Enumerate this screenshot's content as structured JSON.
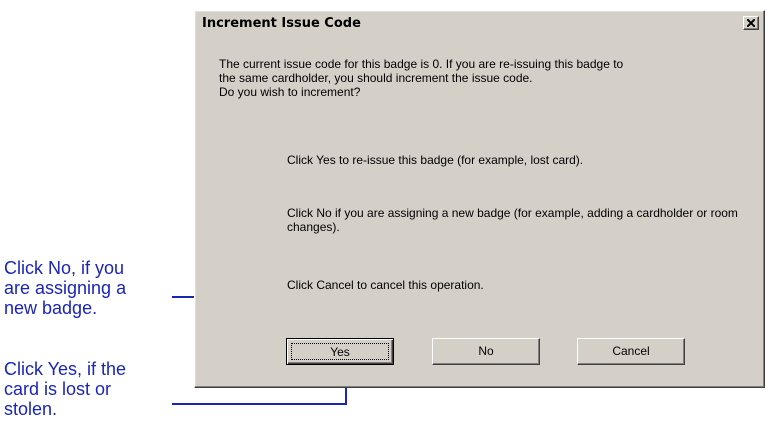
{
  "dialog": {
    "title": "Increment Issue Code",
    "intro_lines": [
      "The current issue code for this badge is 0.  If you are re-issuing this badge to",
      "the same cardholder, you should increment the issue code.",
      "Do you wish to increment?"
    ],
    "yes_hint": "Click Yes to re-issue this badge (for example, lost card).",
    "no_hint": "Click No if you are assigning a new badge (for example, adding a cardholder or room changes).",
    "cancel_hint": "Click Cancel to cancel this operation.",
    "buttons": {
      "yes": "Yes",
      "no": "No",
      "cancel": "Cancel"
    },
    "close_icon": "close-x-icon"
  },
  "callouts": {
    "no": [
      "Click No, if you",
      "are assigning a",
      "new badge."
    ],
    "yes": [
      "Click Yes, if the",
      "card is lost or",
      "stolen."
    ]
  },
  "colors": {
    "callout_blue": "#1a25b8",
    "dialog_face": "#d4d0c8"
  }
}
